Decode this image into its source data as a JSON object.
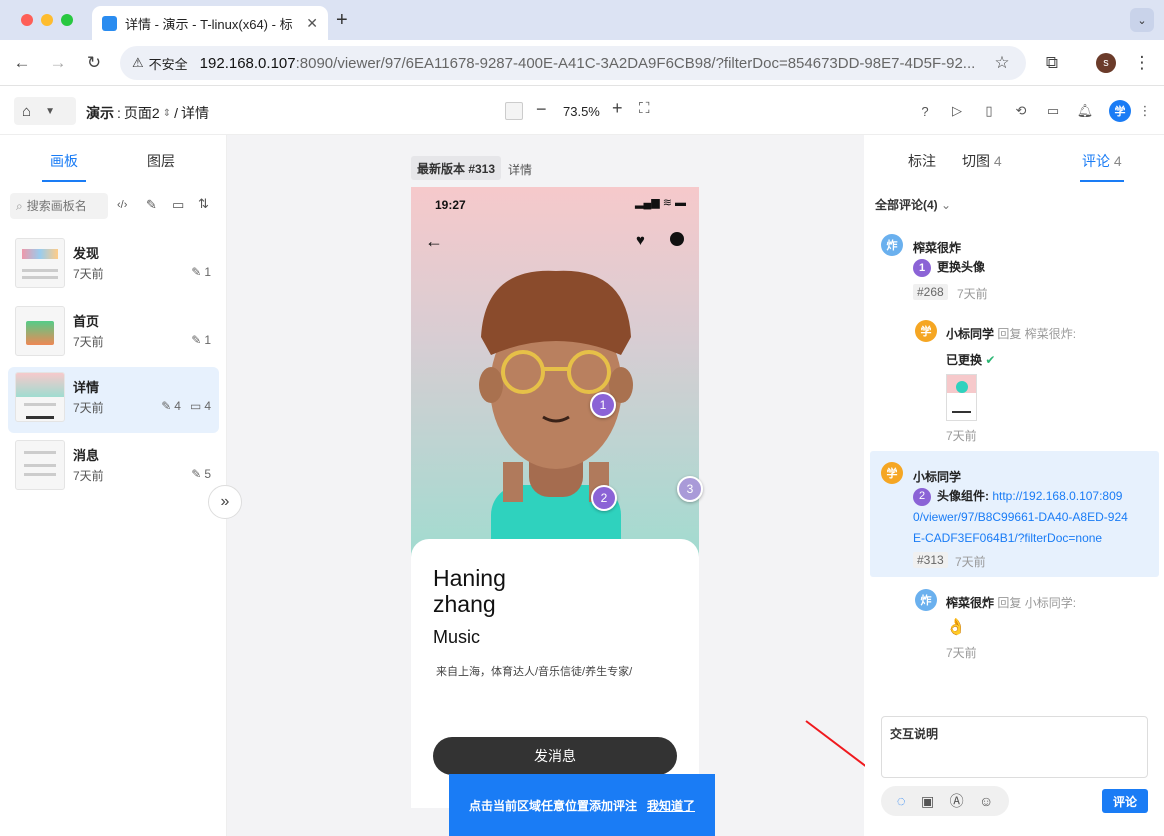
{
  "browser": {
    "tab_title": "详情 - 演示 - T-linux(x64) - 标",
    "insecure_label": "不安全",
    "url_host": "192.168.0.107",
    "url_rest": ":8090/viewer/97/6EA11678-9287-400E-A41C-3A2DA9F6CB98/?filterDoc=854673DD-98E7-4D5F-92...",
    "profile_initial": "s"
  },
  "toolbar": {
    "project": "演示",
    "page": "页面2",
    "board": "详情",
    "zoom": "73.5%",
    "user_initial": "学"
  },
  "left": {
    "tabs": [
      "画板",
      "图层"
    ],
    "search_placeholder": "搜索画板名",
    "boards": [
      {
        "name": "发现",
        "time": "7天前",
        "marks": "1",
        "comments": ""
      },
      {
        "name": "首页",
        "time": "7天前",
        "marks": "1",
        "comments": ""
      },
      {
        "name": "详情",
        "time": "7天前",
        "marks": "4",
        "comments": "4"
      },
      {
        "name": "消息",
        "time": "7天前",
        "marks": "5",
        "comments": ""
      }
    ]
  },
  "canvas": {
    "version_label": "最新版本 #313",
    "board_name": "详情",
    "phone_time": "19:27",
    "person_first": "Haning",
    "person_last": "zhang",
    "role": "Music",
    "bio": "来自上海，体育达人/音乐信徒/养生专家/",
    "message_button": "发消息",
    "pins": [
      "1",
      "2",
      "3"
    ],
    "tip_text": "点击当前区域任意位置添加评注",
    "tip_link": "我知道了"
  },
  "right": {
    "tabs": [
      {
        "label": "标注",
        "count": ""
      },
      {
        "label": "切图",
        "count": "4"
      },
      {
        "label": "评论",
        "count": "4"
      }
    ],
    "filter": "全部评论(4)",
    "comments": [
      {
        "avatar": "炸",
        "user": "榨菜很炸",
        "num": "1",
        "text": "更换头像",
        "tag": "#268",
        "time": "7天前"
      },
      {
        "avatar": "学",
        "user": "小标同学",
        "reply_word": "回复",
        "reply_to": "榨菜很炸:",
        "text": "已更换",
        "check": "✔",
        "time": "7天前"
      },
      {
        "avatar": "学",
        "user": "小标同学",
        "num": "2",
        "label": "头像组件:",
        "link1": "http://192.168.0.107:809",
        "link2": "0/viewer/97/B8C99661-DA40-A8ED-924",
        "link3": "E-CADF3EF064B1/?filterDoc=none",
        "tag": "#313",
        "time": "7天前"
      },
      {
        "avatar": "炸",
        "user": "榨菜很炸",
        "reply_word": "回复",
        "reply_to": "小标同学:",
        "emoji": "👌",
        "time": "7天前"
      }
    ],
    "input_text": "交互说明",
    "submit": "评论"
  },
  "colors": {
    "accent": "#1a7cf5",
    "pin": "#8b63d6",
    "highlight": "#e7f1fd"
  }
}
